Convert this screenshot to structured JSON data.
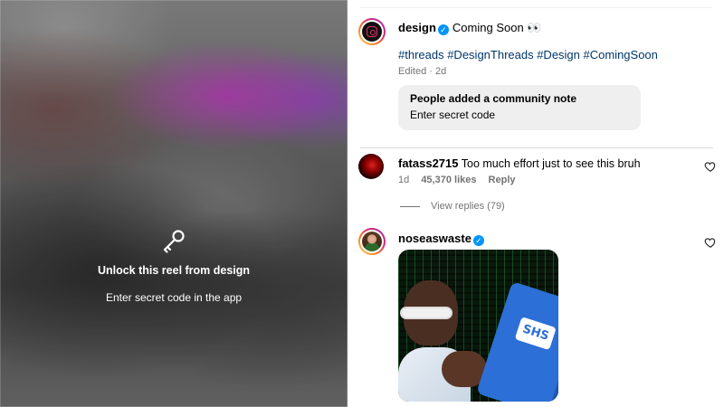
{
  "reel": {
    "unlock_title": "Unlock this reel from design",
    "unlock_subtitle": "Enter secret code in the app",
    "icon": "key-icon"
  },
  "post": {
    "username": "design",
    "verified": true,
    "caption": "Coming Soon 👀",
    "hashtags": "#threads #DesignThreads #Design #ComingSoon",
    "edited": "Edited · 2d",
    "community_note": {
      "title": "People added a community note",
      "text": "Enter secret code"
    }
  },
  "comments": [
    {
      "username": "fatass2715",
      "text": "Too much effort just to see this bruh",
      "time": "1d",
      "likes": "45,370 likes",
      "reply": "Reply",
      "view_replies": "View replies (79)"
    },
    {
      "username": "noseaswaste",
      "verified": true,
      "gif_text": "SHS"
    }
  ],
  "colors": {
    "accent": "#0095f6",
    "hashtag": "#00376b",
    "muted": "#737373",
    "note_bg": "#efefef"
  }
}
